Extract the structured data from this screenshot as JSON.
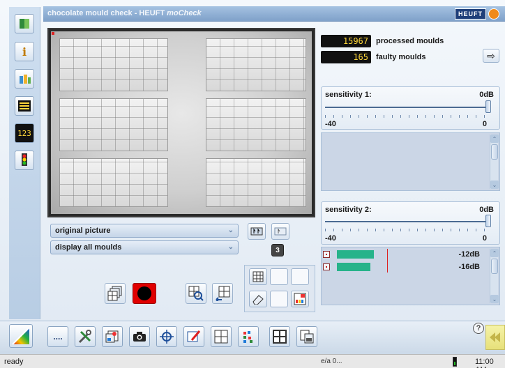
{
  "window": {
    "title": "chocolate mould check - HEUFT",
    "title_product": "moCheck",
    "brand": "HEUFT"
  },
  "left_toolbar": {
    "items": [
      {
        "icon": "door-icon"
      },
      {
        "icon": "info-icon"
      },
      {
        "icon": "bottles-icon"
      },
      {
        "icon": "counter-display-icon"
      },
      {
        "icon": "numbers-123-icon"
      },
      {
        "icon": "traffic-light-icon"
      }
    ]
  },
  "counters": {
    "processed_value": "15967",
    "processed_label": "processed moulds",
    "faulty_value": "165",
    "faulty_label": "faulty moulds"
  },
  "dropdowns": {
    "picture_mode": "original picture",
    "mould_display": "display all moulds"
  },
  "camera_tools": {
    "badge_number": "3"
  },
  "sensitivity1": {
    "title": "sensitivity 1:",
    "value": "0dB",
    "min": "-40",
    "max": "0",
    "level": 1.0
  },
  "sensitivity2": {
    "title": "sensitivity 2:",
    "value": "0dB",
    "min": "-40",
    "max": "0",
    "level": 1.0,
    "levels": [
      {
        "value": "-12dB",
        "fraction": 0.76
      },
      {
        "value": "-16dB",
        "fraction": 0.68
      }
    ]
  },
  "bottom_toolbar": {
    "dots_label": "....",
    "icons": [
      "tools-icon",
      "image-edit-icon",
      "camera-icon",
      "crosshair-icon",
      "brush-icon",
      "grid-icon",
      "dots-pattern-icon",
      "display-grid-icon",
      "copy-icon"
    ],
    "help_icon": "help-icon",
    "corner_icon": "gradient-logo-icon"
  },
  "statusbar": {
    "status": "ready",
    "network": "e/a  0...",
    "time": "11:00 AM"
  },
  "colors": {
    "titlebar": "#8fb0d6",
    "counter_digits": "#ffd83a",
    "level_bar": "#26b38a",
    "record_red": "#e00000"
  }
}
